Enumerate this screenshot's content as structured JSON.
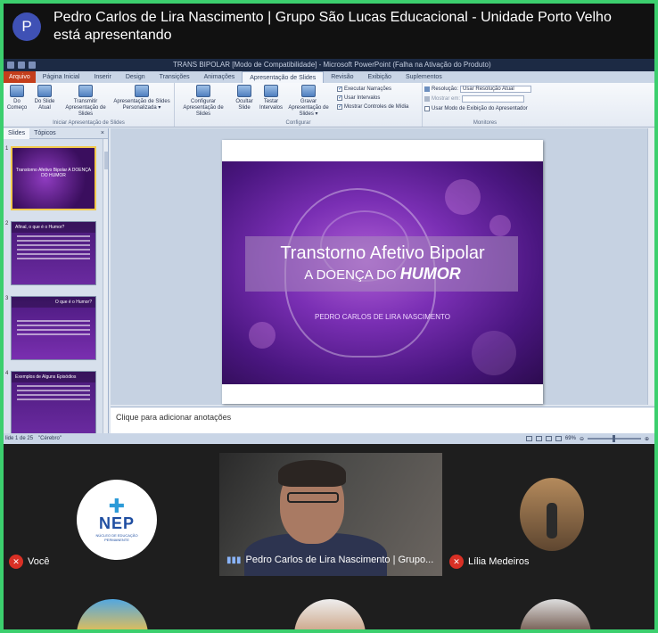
{
  "meeting": {
    "presenting_text": "Pedro Carlos de Lira Nascimento | Grupo São Lucas Educacional - Unidade Porto Velho está apresentando",
    "presenter_initial": "P",
    "accent_color": "#3ccf6e"
  },
  "ppt": {
    "window_title": "TRANS BIPOLAR [Modo de Compatibilidade] - Microsoft PowerPoint (Falha na Ativação do Produto)",
    "tabs": [
      "Arquivo",
      "Página Inicial",
      "Inserir",
      "Design",
      "Transições",
      "Animações",
      "Apresentação de Slides",
      "Revisão",
      "Exibição",
      "Suplementos"
    ],
    "ribbon": {
      "group1_label": "Iniciar Apresentação de Slides",
      "btn_from_start": "Do Começo",
      "btn_from_current": "Do Slide Atual",
      "btn_broadcast": "Transmitir Apresentação de Slides",
      "btn_custom": "Apresentação de Slides Personalizada ▾",
      "group2_label": "Configurar",
      "btn_setup": "Configurar Apresentação de Slides",
      "btn_hide": "Ocultar Slide",
      "btn_rehearse": "Testar Intervalos",
      "btn_record": "Gravar Apresentação de Slides ▾",
      "chk_narration": "Executar Narrações",
      "chk_timings": "Usar Intervalos",
      "chk_media": "Mostrar Controles de Mídia",
      "group3_label": "Monitores",
      "resolution_label": "Resolução:",
      "resolution_value": "Usar Resolução Atual",
      "show_on_label": "Mostrar em:",
      "presenter_view": "Usar Modo de Exibição do Apresentador"
    },
    "left_tabs": {
      "slides": "Slides",
      "topics": "Tópicos",
      "close": "×"
    },
    "thumbnails": [
      {
        "num": "1",
        "title": "Transtorno Afetivo Bipolar A DOENÇA DO HUMOR"
      },
      {
        "num": "2",
        "title": "Afinal, o que é o Humor?"
      },
      {
        "num": "3",
        "title": "O que é o Humor?"
      },
      {
        "num": "4",
        "title": "Exemplos de Alguns Episódios"
      }
    ],
    "slide": {
      "title_line1": "Transtorno Afetivo Bipolar",
      "title_line2_prefix": "A DOENÇA DO",
      "title_line2_emph": "HUMOR",
      "author": "PEDRO CARLOS DE LIRA NASCIMENTO"
    },
    "notes_placeholder": "Clique para adicionar anotações",
    "status": {
      "slide_info": "lide 1 de 25",
      "theme": "\"Cérebro\"",
      "zoom": "69%"
    }
  },
  "participants": {
    "you": {
      "name": "Você",
      "logo_text": "NEP",
      "logo_sub": "NÚCLEO DE EDUCAÇÃO PERMANENTE"
    },
    "speaker": {
      "name": "Pedro Carlos de Lira Nascimento | Grupo..."
    },
    "lilia": {
      "name": "Lília Medeiros"
    }
  },
  "icons": {
    "mic_off": "mic-off-icon",
    "audio_wave": "audio-wave-icon"
  }
}
